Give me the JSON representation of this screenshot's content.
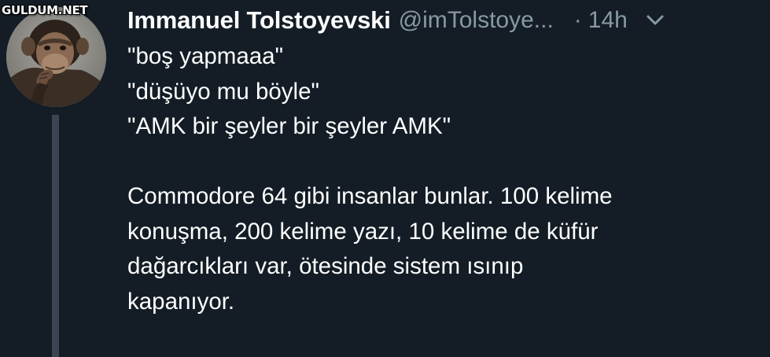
{
  "watermark": "GULDUM.NET",
  "tweet": {
    "author": {
      "display_name": "Immanuel Tolstoyevski",
      "handle": "@imTolstoye..."
    },
    "separator": "·",
    "timestamp": "14h",
    "body_lines": [
      "\"boş yapmaaa\"",
      "\"düşüyo mu böyle\"",
      "\"AMK bir şeyler bir şeyler AMK\"",
      "",
      "Commodore 64 gibi insanlar bunlar. 100 kelime",
      "konuşma, 200 kelime yazı, 10 kelime de küfür",
      "dağarcıkları var, ötesinde sistem ısınıp",
      "kapanıyor."
    ]
  },
  "icons": {
    "avatar": "chimpanzee-avatar",
    "menu": "chevron-down-icon"
  },
  "colors": {
    "background": "#141d26",
    "primary_text": "#ffffff",
    "secondary_text": "#8899a6",
    "thread_line": "#3a4654"
  }
}
